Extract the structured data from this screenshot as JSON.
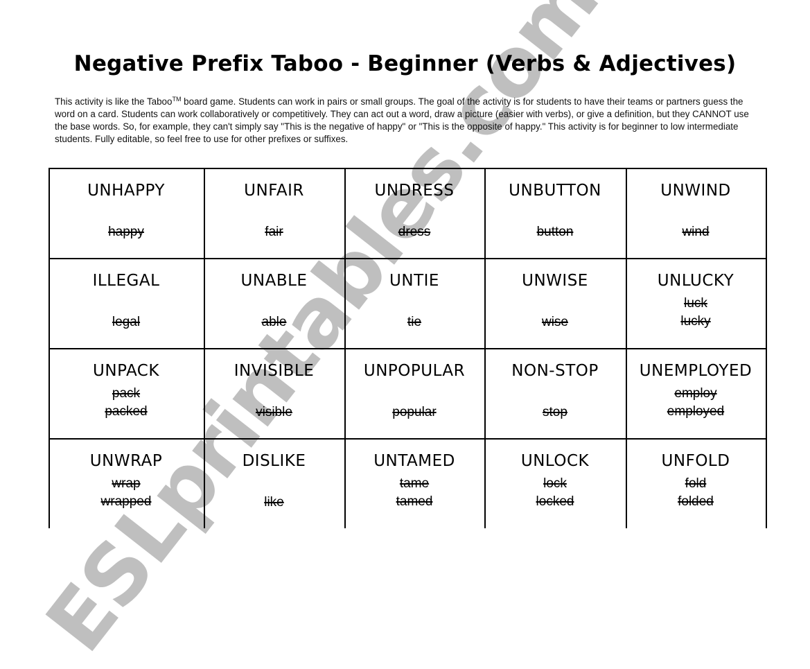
{
  "document": {
    "title": "Negative Prefix Taboo - Beginner (Verbs & Adjectives)",
    "intro": {
      "before_tm": "This activity is like the Taboo",
      "tm": "TM",
      "after_tm": " board game. Students can work in pairs or small groups. The goal of the activity is for students to have their teams or partners guess the word on a card. Students can work collaboratively or competitively. They can act out a word, draw a picture (easier with verbs), or give a definition, but they CANNOT use the base words. So, for example, they can't simply say \"This is the negative of happy\" or \"This is the opposite of happy.\" This activity is for beginner to low intermediate students. Fully editable, so feel free to use for other prefixes or suffixes."
    },
    "cards": [
      {
        "word": "UNHAPPY",
        "taboo": [
          "happy"
        ]
      },
      {
        "word": "UNFAIR",
        "taboo": [
          "fair"
        ]
      },
      {
        "word": "UNDRESS",
        "taboo": [
          "dress"
        ]
      },
      {
        "word": "UNBUTTON",
        "taboo": [
          "button"
        ]
      },
      {
        "word": "UNWIND",
        "taboo": [
          "wind"
        ]
      },
      {
        "word": "ILLEGAL",
        "taboo": [
          "legal"
        ]
      },
      {
        "word": "UNABLE",
        "taboo": [
          "able"
        ]
      },
      {
        "word": "UNTIE",
        "taboo": [
          "tie"
        ]
      },
      {
        "word": "UNWISE",
        "taboo": [
          "wise"
        ]
      },
      {
        "word": "UNLUCKY",
        "taboo": [
          "luck",
          "lucky"
        ]
      },
      {
        "word": "UNPACK",
        "taboo": [
          "pack",
          "packed"
        ]
      },
      {
        "word": "INVISIBLE",
        "taboo": [
          "visible"
        ]
      },
      {
        "word": "UNPOPULAR",
        "taboo": [
          "popular"
        ]
      },
      {
        "word": "NON-STOP",
        "taboo": [
          "stop"
        ]
      },
      {
        "word": "UNEMPLOYED",
        "taboo": [
          "employ",
          "employed"
        ]
      },
      {
        "word": "UNWRAP",
        "taboo": [
          "wrap",
          "wrapped"
        ]
      },
      {
        "word": "DISLIKE",
        "taboo": [
          "like"
        ]
      },
      {
        "word": "UNTAMED",
        "taboo": [
          "tame",
          "tamed"
        ]
      },
      {
        "word": "UNLOCK",
        "taboo": [
          "lock",
          "locked"
        ]
      },
      {
        "word": "UNFOLD",
        "taboo": [
          "fold",
          "folded"
        ]
      }
    ],
    "watermark": "ESLprintables.com"
  }
}
